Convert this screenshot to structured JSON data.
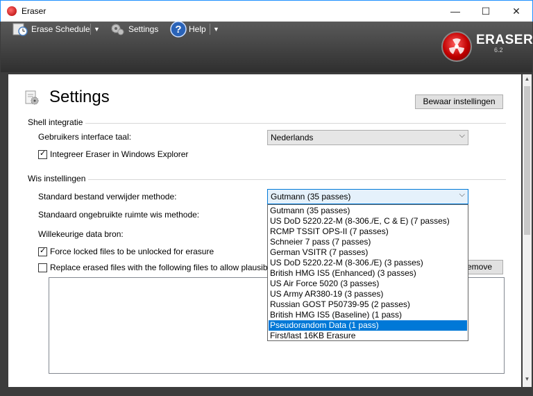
{
  "window": {
    "title": "Eraser",
    "min": "—",
    "max": "☐",
    "close": "✕"
  },
  "toolbar": {
    "erase_schedule": "Erase Schedule",
    "settings": "Settings",
    "help": "Help",
    "dropdown_arrow": "▼"
  },
  "logo": {
    "name": "ERASER",
    "version": "6.2"
  },
  "page": {
    "title": "Settings",
    "save_button": "Bewaar instellingen"
  },
  "shell": {
    "section": "Shell integratie",
    "language_label": "Gebruikers interface taal:",
    "language_value": "Nederlands",
    "explorer_label": "Integreer Eraser in Windows Explorer",
    "explorer_checked": true
  },
  "erase": {
    "section": "Wis instellingen",
    "file_method_label": "Standard bestand verwijder methode:",
    "file_method_value": "Gutmann (35 passes)",
    "unused_method_label": "Standaard ongebruikte ruimte wis methode:",
    "random_source_label": "Willekeurige data bron:",
    "force_unlock_label": "Force locked files to be unlocked for erasure",
    "force_unlock_checked": true,
    "replace_label": "Replace erased files with the following files to allow plausib",
    "replace_checked": false,
    "remove_button": "emove"
  },
  "dropdown": {
    "items": [
      "Gutmann (35 passes)",
      "US DoD 5220.22-M (8-306./E, C & E) (7 passes)",
      "RCMP TSSIT OPS-II (7 passes)",
      "Schneier 7 pass (7 passes)",
      "German VSITR (7 passes)",
      "US DoD 5220.22-M (8-306./E) (3 passes)",
      "British HMG IS5 (Enhanced) (3 passes)",
      "US Air Force 5020 (3 passes)",
      "US Army AR380-19 (3 passes)",
      "Russian GOST P50739-95 (2 passes)",
      "British HMG IS5 (Baseline) (1 pass)",
      "Pseudorandom Data (1 pass)",
      "First/last 16KB Erasure"
    ],
    "selected_index": 11
  },
  "combo_arrow": "⌵",
  "colors": {
    "accent": "#0078d7",
    "toolbar_bg": "#3a3a3a",
    "logo_red": "#c00000"
  }
}
